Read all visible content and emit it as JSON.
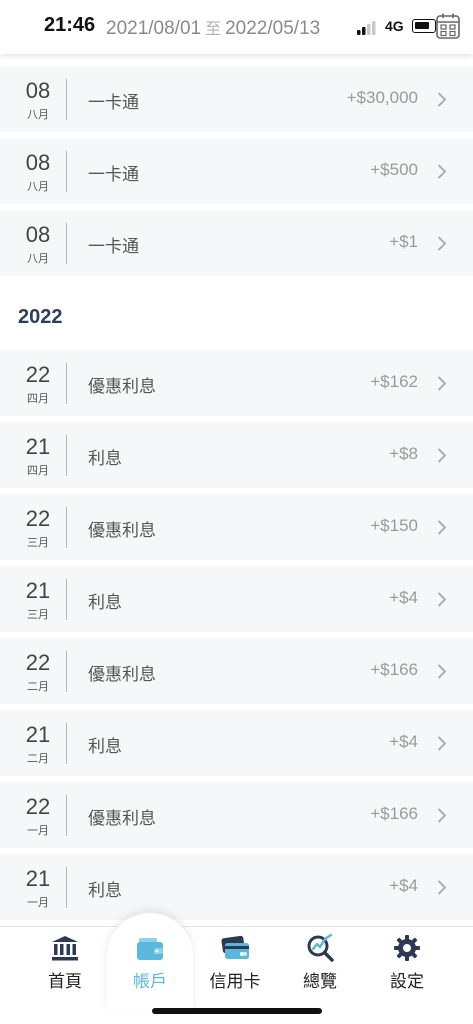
{
  "status": {
    "time": "21:46",
    "network": "4G"
  },
  "header": {
    "start_date": "2021/08/01",
    "separator": "至",
    "end_date": "2022/05/13"
  },
  "transactions_top": [
    {
      "day": "08",
      "month": "八月",
      "desc": "一卡通",
      "amount": "+$30,000"
    },
    {
      "day": "08",
      "month": "八月",
      "desc": "一卡通",
      "amount": "+$500"
    },
    {
      "day": "08",
      "month": "八月",
      "desc": "一卡通",
      "amount": "+$1"
    }
  ],
  "year_header": "2022",
  "transactions_2022": [
    {
      "day": "22",
      "month": "四月",
      "desc": "優惠利息",
      "amount": "+$162"
    },
    {
      "day": "21",
      "month": "四月",
      "desc": "利息",
      "amount": "+$8"
    },
    {
      "day": "22",
      "month": "三月",
      "desc": "優惠利息",
      "amount": "+$150"
    },
    {
      "day": "21",
      "month": "三月",
      "desc": "利息",
      "amount": "+$4"
    },
    {
      "day": "22",
      "month": "二月",
      "desc": "優惠利息",
      "amount": "+$166"
    },
    {
      "day": "21",
      "month": "二月",
      "desc": "利息",
      "amount": "+$4"
    },
    {
      "day": "22",
      "month": "一月",
      "desc": "優惠利息",
      "amount": "+$166"
    },
    {
      "day": "21",
      "month": "一月",
      "desc": "利息",
      "amount": "+$4"
    }
  ],
  "tabs": [
    {
      "label": "首頁",
      "icon": "bank-icon"
    },
    {
      "label": "帳戶",
      "icon": "wallet-icon"
    },
    {
      "label": "信用卡",
      "icon": "credit-card-icon"
    },
    {
      "label": "總覽",
      "icon": "analytics-search-icon"
    },
    {
      "label": "設定",
      "icon": "gear-icon"
    }
  ],
  "colors": {
    "accent": "#5ab8dc",
    "year_header": "#2b3f5c",
    "row_bg": "#f6f7f9",
    "amount_text": "#9a9a9a"
  }
}
